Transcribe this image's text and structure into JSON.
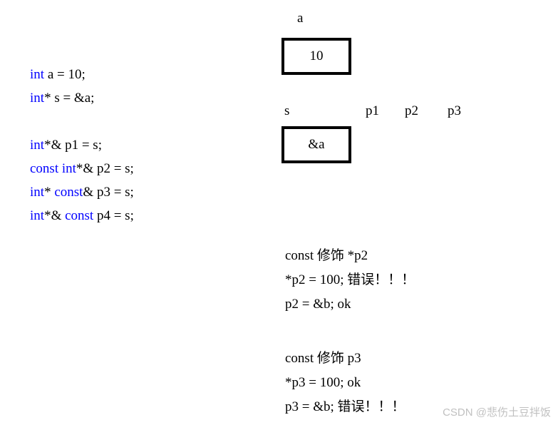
{
  "code": {
    "l1": {
      "kw": "int",
      "rest": " a = 10;"
    },
    "l2": {
      "kw": "int",
      "rest": "* s = &a;"
    },
    "blank1": "",
    "l3": {
      "kw": "int",
      "rest": "*& p1 = s;"
    },
    "l4": {
      "kw": "const int",
      "rest": "*& p2 = s;"
    },
    "l5": {
      "kw1": "int",
      "mid": "* ",
      "kw2": "const",
      "rest": "& p3 = s;"
    },
    "l6": {
      "kw1": "int",
      "mid": "*& ",
      "kw2": "const",
      "rest": " p4 = s;"
    }
  },
  "diagram": {
    "label_a": "a",
    "box_a": "10",
    "label_s": "s",
    "label_p1": "p1",
    "label_p2": "p2",
    "label_p3": "p3",
    "box_s": "&a"
  },
  "notes_p2": {
    "l1": "const 修饰 *p2",
    "l2": "*p2 = 100; 错误！！！",
    "l3_a": "p2 = &b; ",
    "l3_b": "ok"
  },
  "notes_p3": {
    "l1": "const 修饰 p3",
    "l2": "*p3 = 100; ok",
    "l3": "p3 = &b; 错误！！！"
  },
  "watermark": "CSDN @悲伤土豆拌饭"
}
